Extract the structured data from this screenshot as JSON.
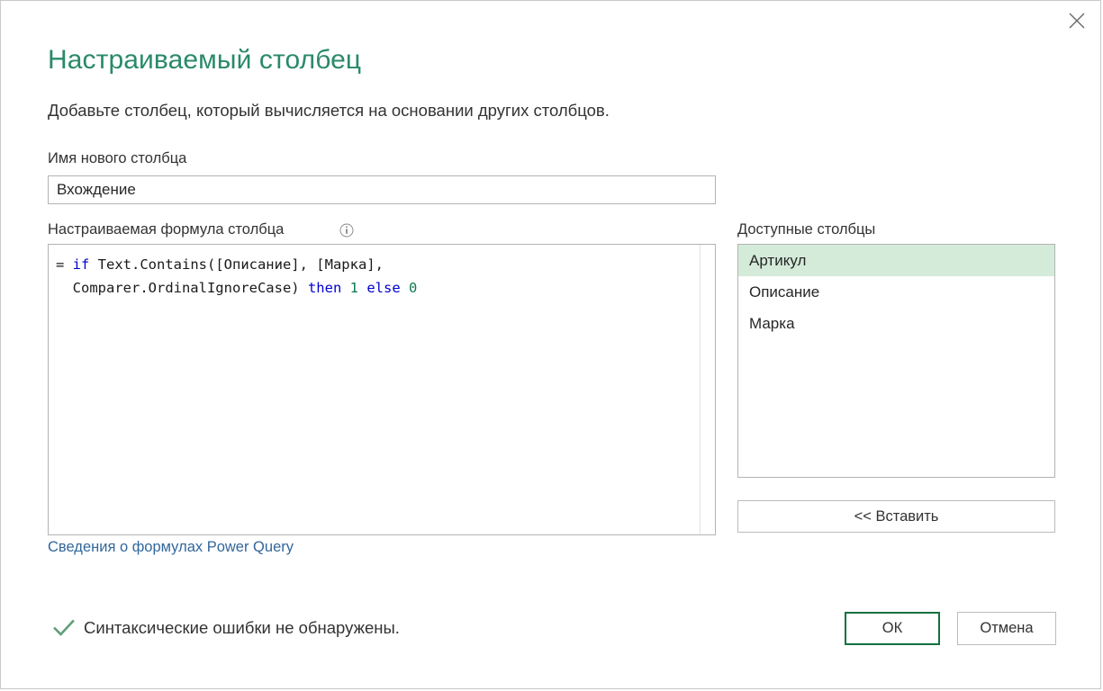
{
  "dialog": {
    "title": "Настраиваемый столбец",
    "subtitle": "Добавьте столбец, который вычисляется на основании других столбцов.",
    "close_icon": "close-icon"
  },
  "new_column": {
    "label": "Имя нового столбца",
    "value": "Вхождение",
    "placeholder": ""
  },
  "formula": {
    "label": "Настраиваемая формула столбца",
    "info_icon": "info-icon",
    "line1_prefix": "= ",
    "line1_kw": "if",
    "line1_rest": " Text.Contains([Описание], [Марка],",
    "line2_prefix": "  Comparer.OrdinalIgnoreCase) ",
    "line2_kw_then": "then",
    "line2_num_one": "1",
    "line2_kw_else": "else",
    "line2_num_zero": "0",
    "full_text": "= if Text.Contains([Описание], [Марка],\n  Comparer.OrdinalIgnoreCase) then 1 else 0"
  },
  "help_link": {
    "label": "Сведения о формулах Power Query"
  },
  "available_columns": {
    "label": "Доступные столбцы",
    "items": [
      {
        "label": "Артикул",
        "selected": true
      },
      {
        "label": "Описание",
        "selected": false
      },
      {
        "label": "Марка",
        "selected": false
      }
    ],
    "insert_button": "<< Вставить"
  },
  "status": {
    "icon": "checkmark-icon",
    "text": "Синтаксические ошибки не обнаружены.",
    "color": "#5e9e79"
  },
  "footer": {
    "ok_label": "ОК",
    "cancel_label": "Отмена"
  },
  "colors": {
    "title": "#2a8a68",
    "link": "#31679c",
    "selection": "#d5ebd9",
    "ok_border": "#13713f",
    "keyword": "#0000d0",
    "number": "#0f7a4f"
  }
}
